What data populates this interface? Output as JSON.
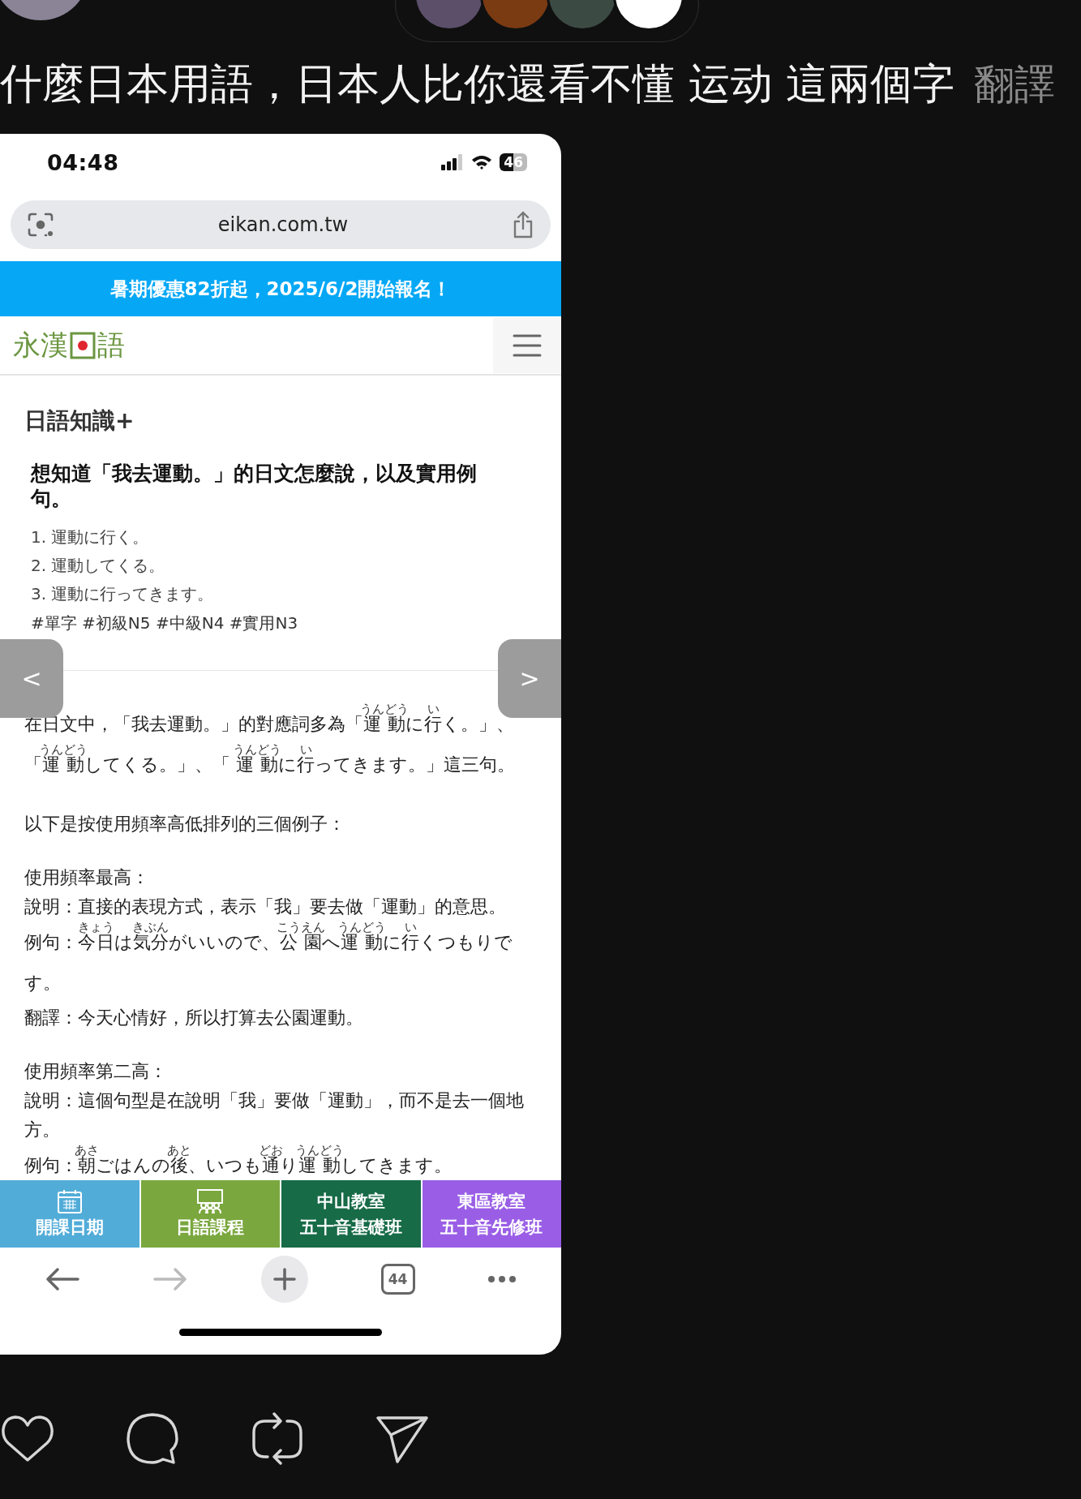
{
  "post": {
    "text": "什麼日本用語，日本人比你還看不懂 运动 這兩個字",
    "translate_link": "翻譯"
  },
  "screenshot": {
    "status_bar": {
      "time": "04:48",
      "battery": "46"
    },
    "url_bar": {
      "url": "eikan.com.tw"
    },
    "banner": "暑期優惠82折起，2025/6/2開始報名！",
    "site_header": {
      "logo_parts": [
        "永漢",
        "語"
      ]
    },
    "category": "日語知識+",
    "title": "想知道「我去運動。」的日文怎麼說，以及實用例句。",
    "list": [
      "1. 運動に行く。",
      "2. 運動してくる。",
      "3. 運動に行ってきます。"
    ],
    "tags": "#單字 #初級N5 #中級N4 #實用N3",
    "carousel_nav": [
      "<",
      ">"
    ],
    "body": [
      {
        "lines": [
          [
            {
              "text": "在日文中，「我去運動。」的對應詞多為「"
            },
            {
              "text": "運動",
              "ruby": "うんどう"
            },
            {
              "text": "に"
            },
            {
              "text": "行",
              "ruby": "い"
            },
            {
              "text": "く。」、「"
            },
            {
              "text": "運動",
              "ruby": "うんどう"
            },
            {
              "text": "してくる。」、「 "
            },
            {
              "text": "運動",
              "ruby": "うんどう"
            },
            {
              "text": "に"
            },
            {
              "text": "行",
              "ruby": "い"
            },
            {
              "text": "ってきます。」這三句。"
            }
          ]
        ]
      },
      {
        "lines": [
          [
            {
              "text": "以下是按使用頻率高低排列的三個例子："
            }
          ]
        ]
      },
      {
        "lines": [
          [
            {
              "text": "使用頻率最高："
            }
          ],
          [
            {
              "text": "說明：直接的表現方式，表示「我」要去做「運動」的意思。"
            }
          ],
          [
            {
              "text": "例句："
            },
            {
              "text": "今日",
              "ruby": "きょう"
            },
            {
              "text": "は"
            },
            {
              "text": "気分",
              "ruby": "きぶん"
            },
            {
              "text": "がいいので、"
            },
            {
              "text": "公園",
              "ruby": "こうえん"
            },
            {
              "text": "へ"
            },
            {
              "text": "運動",
              "ruby": "うんどう"
            },
            {
              "text": "に"
            },
            {
              "text": "行",
              "ruby": "い"
            },
            {
              "text": "くつもりです。"
            }
          ],
          [
            {
              "text": "翻譯：今天心情好，所以打算去公園運動。"
            }
          ]
        ]
      },
      {
        "lines": [
          [
            {
              "text": "使用頻率第二高："
            }
          ],
          [
            {
              "text": "說明：這個句型是在說明「我」要做「運動」，而不是去一個地方。"
            }
          ],
          [
            {
              "text": "例句："
            },
            {
              "text": "朝",
              "ruby": "あさ"
            },
            {
              "text": "ごはんの"
            },
            {
              "text": "後",
              "ruby": "あと"
            },
            {
              "text": "、いつも"
            },
            {
              "text": "通",
              "ruby": "どお"
            },
            {
              "text": "り"
            },
            {
              "text": "運動",
              "ruby": "うんどう"
            },
            {
              "text": "してきます。"
            }
          ]
        ]
      }
    ],
    "bottom_tabs": [
      {
        "kind": "calendar",
        "lines": [
          "開課日期"
        ],
        "color": "#52acd8"
      },
      {
        "kind": "classroom",
        "lines": [
          "日語課程"
        ],
        "color": "#7aa73e"
      },
      {
        "kind": "text",
        "lines": [
          "中山教室",
          "五十音基礎班"
        ],
        "color": "#176b47"
      },
      {
        "kind": "text",
        "lines": [
          "東區教室",
          "五十音先修班"
        ],
        "color": "#9a5ee6"
      }
    ],
    "toolbar": {
      "back": {
        "disabled": false
      },
      "forward": {
        "disabled": true
      },
      "tabs": {
        "count": "44"
      }
    }
  }
}
